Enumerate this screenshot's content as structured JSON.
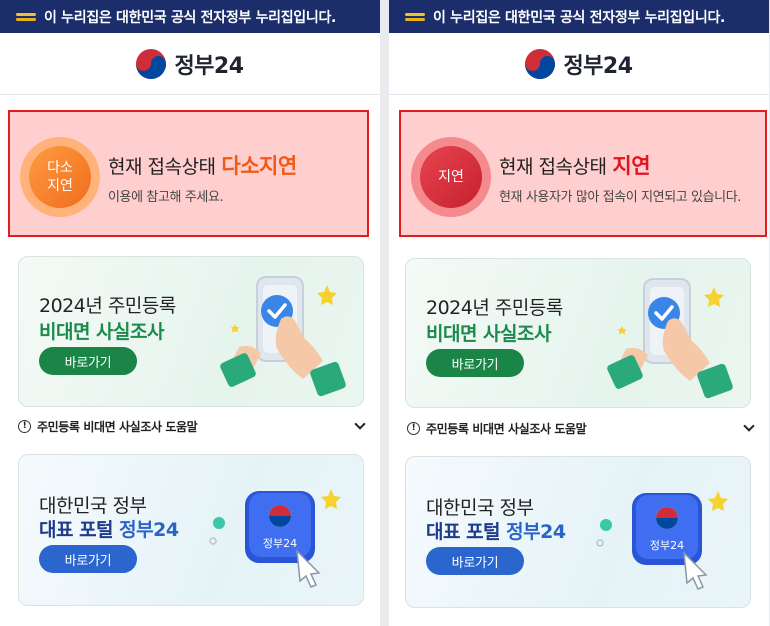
{
  "panels": [
    {
      "banner": "이 누리집은 대한민국 공식 전자정부 누리집입니다.",
      "logo_text": "정부24",
      "status": {
        "circle_label_1": "다소",
        "circle_label_2": "지연",
        "title_prefix": "현재 접속상태",
        "title_highlight": "다소지연",
        "subtitle": "이용에 참고해 주세요."
      },
      "card1": {
        "line1": "2024년 주민등록",
        "line2": "비대면 사실조사",
        "button": "바로가기"
      },
      "help": "주민등록 비대면 사실조사 도움말",
      "card2": {
        "line1": "대한민국 정부",
        "line2_a": "대표 포털 ",
        "line2_b": "정부24",
        "button": "바로가기",
        "tile_label": "정부24"
      }
    },
    {
      "banner": "이 누리집은 대한민국 공식 전자정부 누리집입니다.",
      "logo_text": "정부24",
      "status": {
        "circle_label_1": "지연",
        "circle_label_2": "",
        "title_prefix": "현재 접속상태",
        "title_highlight": "지연",
        "subtitle": "현재 사용자가 많아 접속이 지연되고 있습니다."
      },
      "card1": {
        "line1": "2024년 주민등록",
        "line2": "비대면 사실조사",
        "button": "바로가기"
      },
      "help": "주민등록 비대면 사실조사 도움말",
      "card2": {
        "line1": "대한민국 정부",
        "line2_a": "대표 포털 ",
        "line2_b": "정부24",
        "button": "바로가기",
        "tile_label": "정부24"
      }
    }
  ],
  "colors": {
    "banner_bg": "#1c2d6b",
    "status_border": "#e11c1c",
    "status_bg": "#ffcfcf",
    "orange_highlight": "#f05a14",
    "red_highlight": "#e2141f",
    "green_button": "#1b8548",
    "blue_button": "#2a66cd"
  }
}
